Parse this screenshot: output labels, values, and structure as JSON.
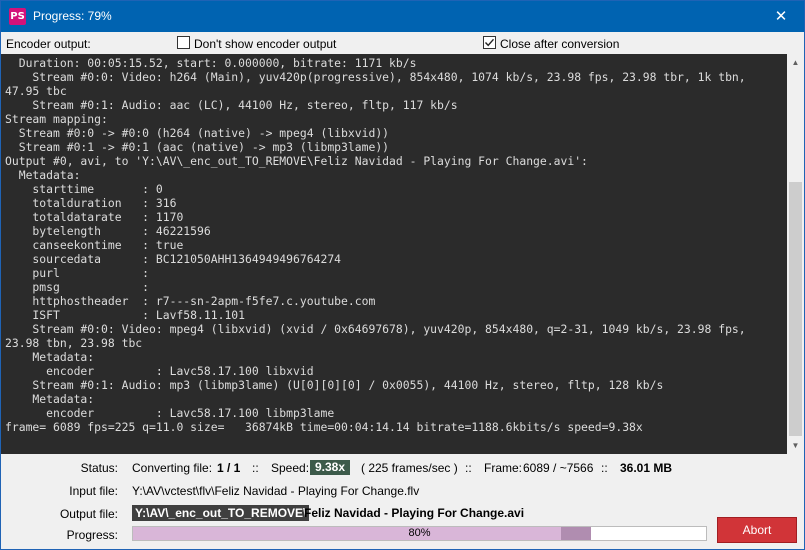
{
  "window": {
    "app_icon_text": "PS",
    "title": "Progress: 79%",
    "close_glyph": "✕"
  },
  "options": {
    "encoder_output_label": "Encoder output:",
    "dont_show_label": "Don't show encoder output",
    "dont_show_checked": false,
    "close_after_label": "Close after conversion",
    "close_after_checked": true
  },
  "console": {
    "lines": "  Duration: 00:05:15.52, start: 0.000000, bitrate: 1171 kb/s\n    Stream #0:0: Video: h264 (Main), yuv420p(progressive), 854x480, 1074 kb/s, 23.98 fps, 23.98 tbr, 1k tbn,\n47.95 tbc\n    Stream #0:1: Audio: aac (LC), 44100 Hz, stereo, fltp, 117 kb/s\nStream mapping:\n  Stream #0:0 -> #0:0 (h264 (native) -> mpeg4 (libxvid))\n  Stream #0:1 -> #0:1 (aac (native) -> mp3 (libmp3lame))\nOutput #0, avi, to 'Y:\\AV\\_enc_out_TO_REMOVE\\Feliz Navidad - Playing For Change.avi':\n  Metadata:\n    starttime       : 0\n    totalduration   : 316\n    totaldatarate   : 1170\n    bytelength      : 46221596\n    canseekontime   : true\n    sourcedata      : BC121050AHH1364949496764274\n    purl            :\n    pmsg            :\n    httphostheader  : r7---sn-2apm-f5fe7.c.youtube.com\n    ISFT            : Lavf58.11.101\n    Stream #0:0: Video: mpeg4 (libxvid) (xvid / 0x64697678), yuv420p, 854x480, q=2-31, 1049 kb/s, 23.98 fps,\n23.98 tbn, 23.98 tbc\n    Metadata:\n      encoder         : Lavc58.17.100 libxvid\n    Stream #0:1: Audio: mp3 (libmp3lame) (U[0][0][0] / 0x0055), 44100 Hz, stereo, fltp, 128 kb/s\n    Metadata:\n      encoder         : Lavc58.17.100 libmp3lame\nframe= 6089 fps=225 q=11.0 size=   36874kB time=00:04:14.14 bitrate=1188.6kbits/s speed=9.38x"
  },
  "status": {
    "status_label": "Status:",
    "converting_label": "Converting file:",
    "converting_value": "1 / 1",
    "sep": "::",
    "speed_label": "Speed:",
    "speed_value": "9.38x",
    "frames_per_sec": "( 225 frames/sec )",
    "frame_label": "Frame:",
    "frame_value": "6089 / ~7566",
    "size_value": "36.01 MB",
    "input_label": "Input file:",
    "input_value": "Y:\\AV\\vctest\\flv\\Feliz Navidad - Playing For Change.flv",
    "output_label": "Output file:",
    "output_dir": "Y:\\AV\\_enc_out_TO_REMOVE\\",
    "output_name": "Feliz Navidad - Playing For Change.avi",
    "progress_label": "Progress:",
    "progress_text": "80%",
    "progress_fraction": 0.8,
    "abort_label": "Abort",
    "abort_color": "#d13438"
  }
}
